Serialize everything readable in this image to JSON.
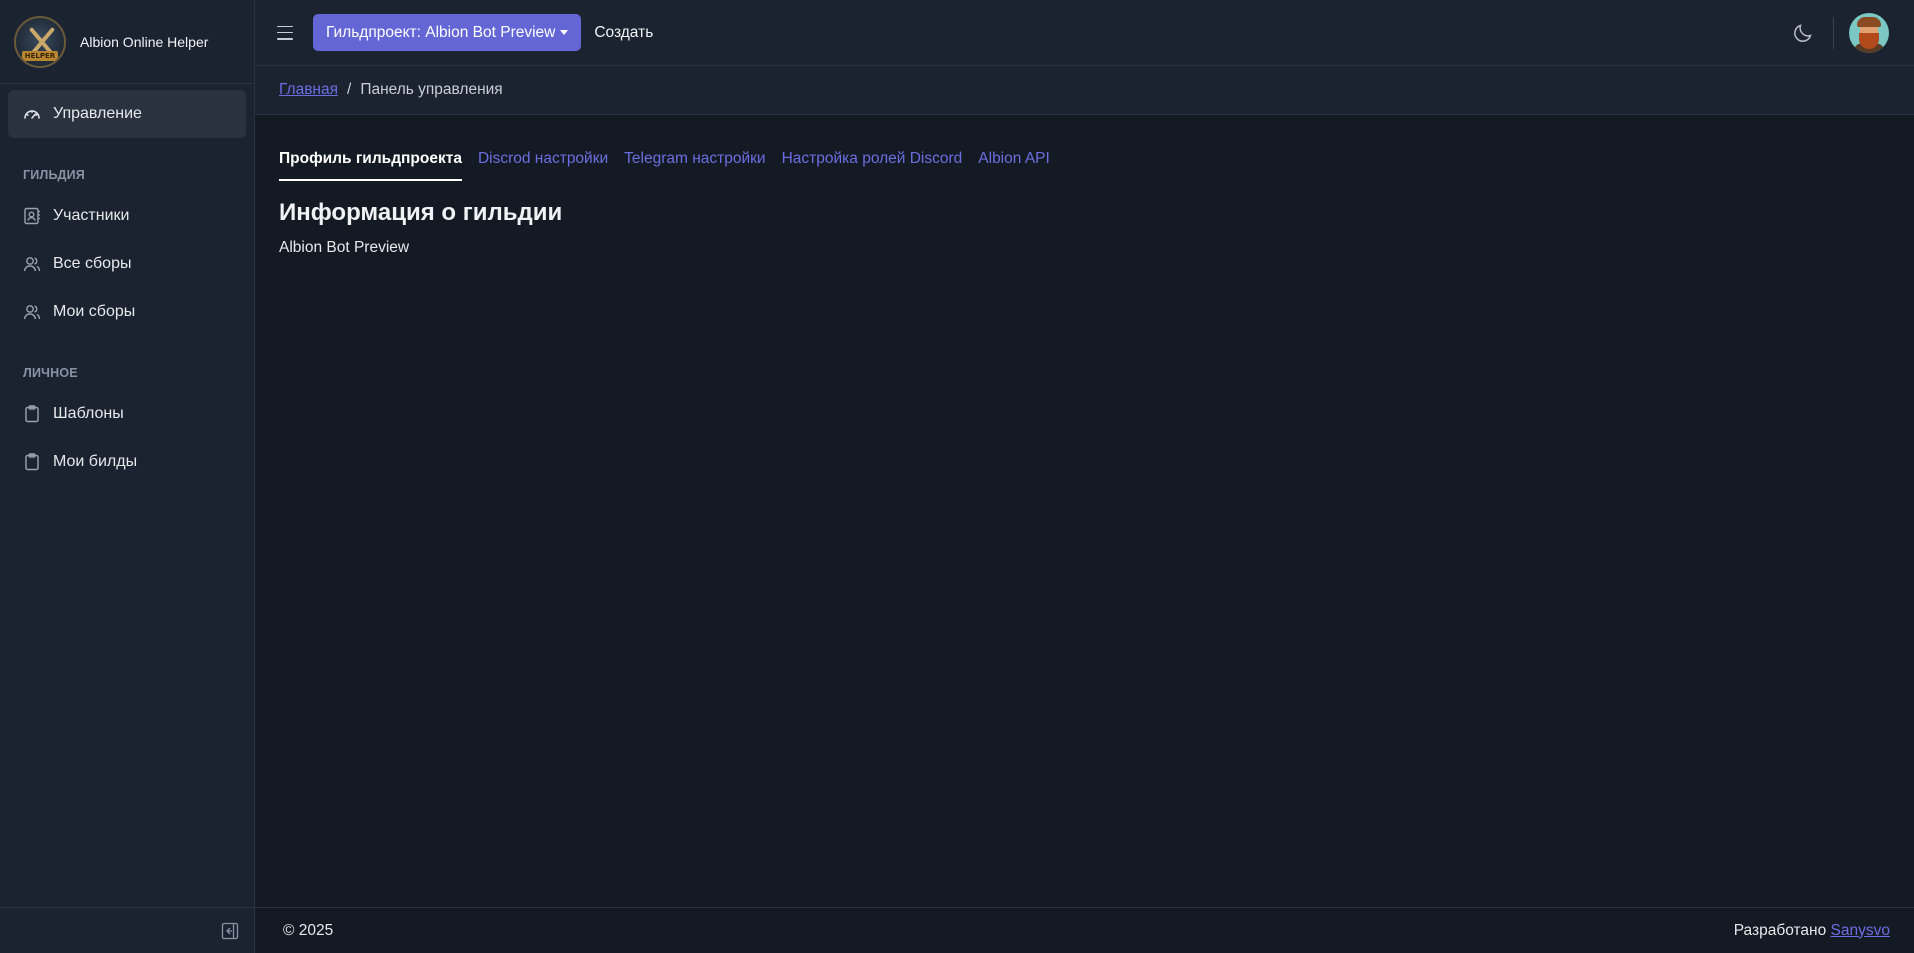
{
  "brand": {
    "title": "Albion Online Helper",
    "logo_text": "HELPER"
  },
  "sidebar": {
    "items_main": [
      {
        "label": "Управление",
        "icon": "gauge-icon",
        "active": true
      }
    ],
    "section_guild": "ГИЛЬДИЯ",
    "items_guild": [
      {
        "label": "Участники",
        "icon": "contact-book-icon"
      },
      {
        "label": "Все сборы",
        "icon": "users-icon"
      },
      {
        "label": "Мои сборы",
        "icon": "users-icon"
      }
    ],
    "section_personal": "ЛИЧНОЕ",
    "items_personal": [
      {
        "label": "Шаблоны",
        "icon": "clipboard-icon"
      },
      {
        "label": "Мои билды",
        "icon": "clipboard-icon"
      }
    ]
  },
  "topbar": {
    "guild_button": "Гильдпроект: Albion Bot Preview",
    "create_link": "Создать"
  },
  "breadcrumb": {
    "home": "Главная",
    "separator": "/",
    "current": "Панель управления"
  },
  "tabs": [
    {
      "label": "Профиль гильдпроекта",
      "active": true
    },
    {
      "label": "Discrod настройки"
    },
    {
      "label": "Telegram настройки"
    },
    {
      "label": "Настройка ролей Discord"
    },
    {
      "label": "Albion API"
    }
  ],
  "main": {
    "title": "Информация о гильдии",
    "guild_name": "Albion Bot Preview"
  },
  "footer": {
    "copyright": "© 2025",
    "developed_by": "Разработано",
    "author": "Sanysvo"
  },
  "colors": {
    "background": "#141a23",
    "panel": "#1b2230",
    "accent": "#6466d6",
    "link": "#6b6ee0"
  }
}
